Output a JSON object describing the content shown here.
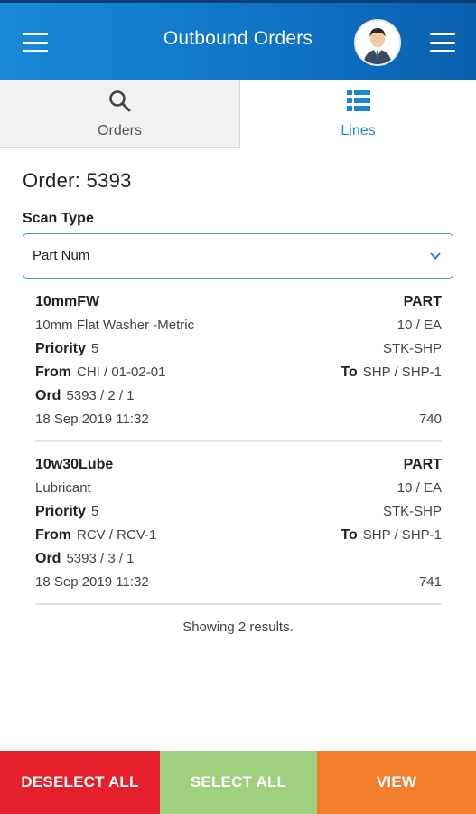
{
  "header": {
    "title": "Outbound Orders",
    "left_menu_icon": "hamburger-icon",
    "right_menu_icon": "hamburger-icon",
    "avatar_icon": "user-avatar-icon",
    "gradient_colors": [
      "#1a8ad8",
      "#0a5fae"
    ]
  },
  "tabs": [
    {
      "label": "Orders",
      "icon": "search-icon",
      "active": false
    },
    {
      "label": "Lines",
      "icon": "list-icon",
      "active": true,
      "color": "#1a86d6"
    }
  ],
  "order": {
    "title": "Order: 5393"
  },
  "scan_type": {
    "label": "Scan Type",
    "selected": "Part Num"
  },
  "lines": [
    {
      "part": "10mmFW",
      "type": "PART",
      "description": "10mm Flat Washer -Metric",
      "qty_uom": "10 / EA",
      "priority_label": "Priority",
      "priority": "5",
      "route": "STK-SHP",
      "from_label": "From",
      "from": "CHI / 01-02-01",
      "to_label": "To",
      "to": "SHP / SHP-1",
      "ord_label": "Ord",
      "ord": "5393 / 2 / 1",
      "date": "18 Sep 2019 11:32",
      "number": "740"
    },
    {
      "part": "10w30Lube",
      "type": "PART",
      "description": "Lubricant",
      "qty_uom": "10 / EA",
      "priority_label": "Priority",
      "priority": "5",
      "route": "STK-SHP",
      "from_label": "From",
      "from": "RCV / RCV-1",
      "to_label": "To",
      "to": "SHP / SHP-1",
      "ord_label": "Ord",
      "ord": "5393 / 3 / 1",
      "date": "18 Sep 2019 11:32",
      "number": "741"
    }
  ],
  "results_text": "Showing 2 results.",
  "actions": {
    "deselect_all": "DESELECT ALL",
    "select_all": "SELECT ALL",
    "view": "VIEW",
    "colors": {
      "deselect": "#e5202a",
      "select": "#9fd07e",
      "view": "#f07e2a"
    }
  }
}
